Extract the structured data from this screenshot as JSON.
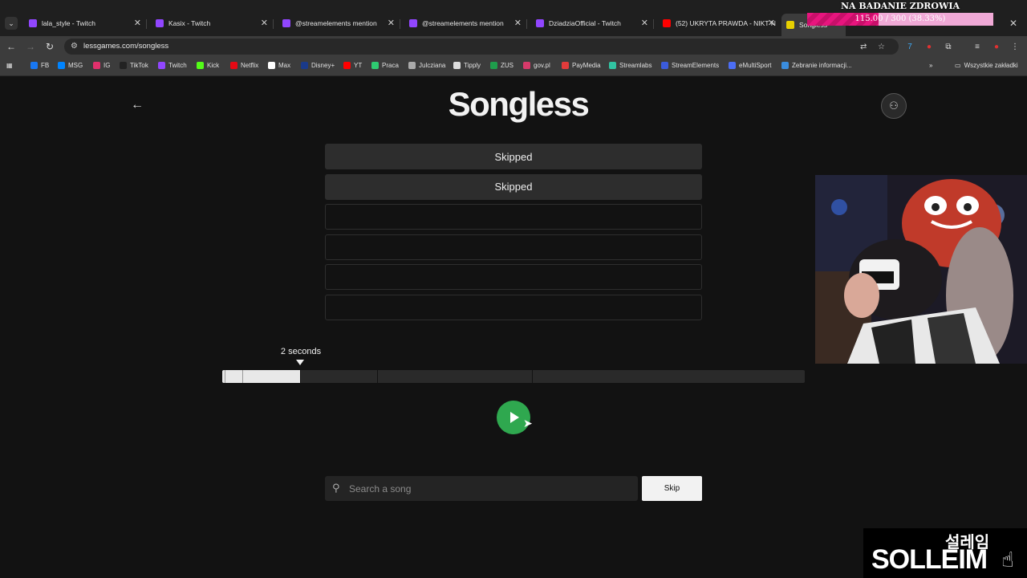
{
  "browser": {
    "tabs": [
      {
        "title": "lala_style - Twitch",
        "color": "#9146ff"
      },
      {
        "title": "Kasix - Twitch",
        "color": "#9146ff"
      },
      {
        "title": "@streamelements mention",
        "color": "#9146ff"
      },
      {
        "title": "@streamelements mention",
        "color": "#9146ff"
      },
      {
        "title": "DziadziaOfficial - Twitch",
        "color": "#9146ff"
      },
      {
        "title": "(52) UKRYTA PRAWDA - NIKT N",
        "color": "#ff0000"
      },
      {
        "title": "Songless",
        "color": "#e8d000"
      }
    ],
    "url": "lessgames.com/songless",
    "bookmarks": [
      {
        "label": "FB",
        "color": "#1877f2"
      },
      {
        "label": "MSG",
        "color": "#0084ff"
      },
      {
        "label": "IG",
        "color": "#e1306c"
      },
      {
        "label": "TikTok",
        "color": "#222222"
      },
      {
        "label": "Twitch",
        "color": "#9146ff"
      },
      {
        "label": "Kick",
        "color": "#53fc18"
      },
      {
        "label": "Netflix",
        "color": "#e50914"
      },
      {
        "label": "Max",
        "color": "#ffffff"
      },
      {
        "label": "Disney+",
        "color": "#1a3a8a"
      },
      {
        "label": "YT",
        "color": "#ff0000"
      },
      {
        "label": "Praca",
        "color": "#2ecc71"
      },
      {
        "label": "Julcziana",
        "color": "#aaaaaa"
      },
      {
        "label": "Tipply",
        "color": "#dddddd"
      },
      {
        "label": "ZUS",
        "color": "#1f9d4c"
      },
      {
        "label": "gov.pl",
        "color": "#d63a6a"
      },
      {
        "label": "PayMedia",
        "color": "#e33b3b"
      },
      {
        "label": "Streamlabs",
        "color": "#31c3a2"
      },
      {
        "label": "StreamElements",
        "color": "#3b5bdb"
      },
      {
        "label": "eMultiSport",
        "color": "#4c6ef5"
      },
      {
        "label": "Zebranie informacji...",
        "color": "#3a8dde"
      }
    ],
    "all_bookmarks_label": "Wszystkie zakładki"
  },
  "overlay": {
    "donation_title": "NA BADANIE ZDROWIA",
    "donation_progress": "115.00 / 300 (38.33%)",
    "donation_fraction": 0.3833,
    "watermark_korean": "설레임",
    "watermark_main": "SOLLEIM"
  },
  "app": {
    "logo": "Songless",
    "guesses": [
      {
        "text": "Skipped",
        "state": "skipped"
      },
      {
        "text": "Skipped",
        "state": "skipped"
      },
      {
        "text": "",
        "state": "empty"
      },
      {
        "text": "",
        "state": "empty"
      },
      {
        "text": "",
        "state": "empty"
      },
      {
        "text": "",
        "state": "empty"
      }
    ],
    "seconds_label": "2 seconds",
    "timeline_progress": 0.133,
    "search_placeholder": "Search a song",
    "skip_label": "Skip",
    "accent_color": "#2fa84f"
  }
}
